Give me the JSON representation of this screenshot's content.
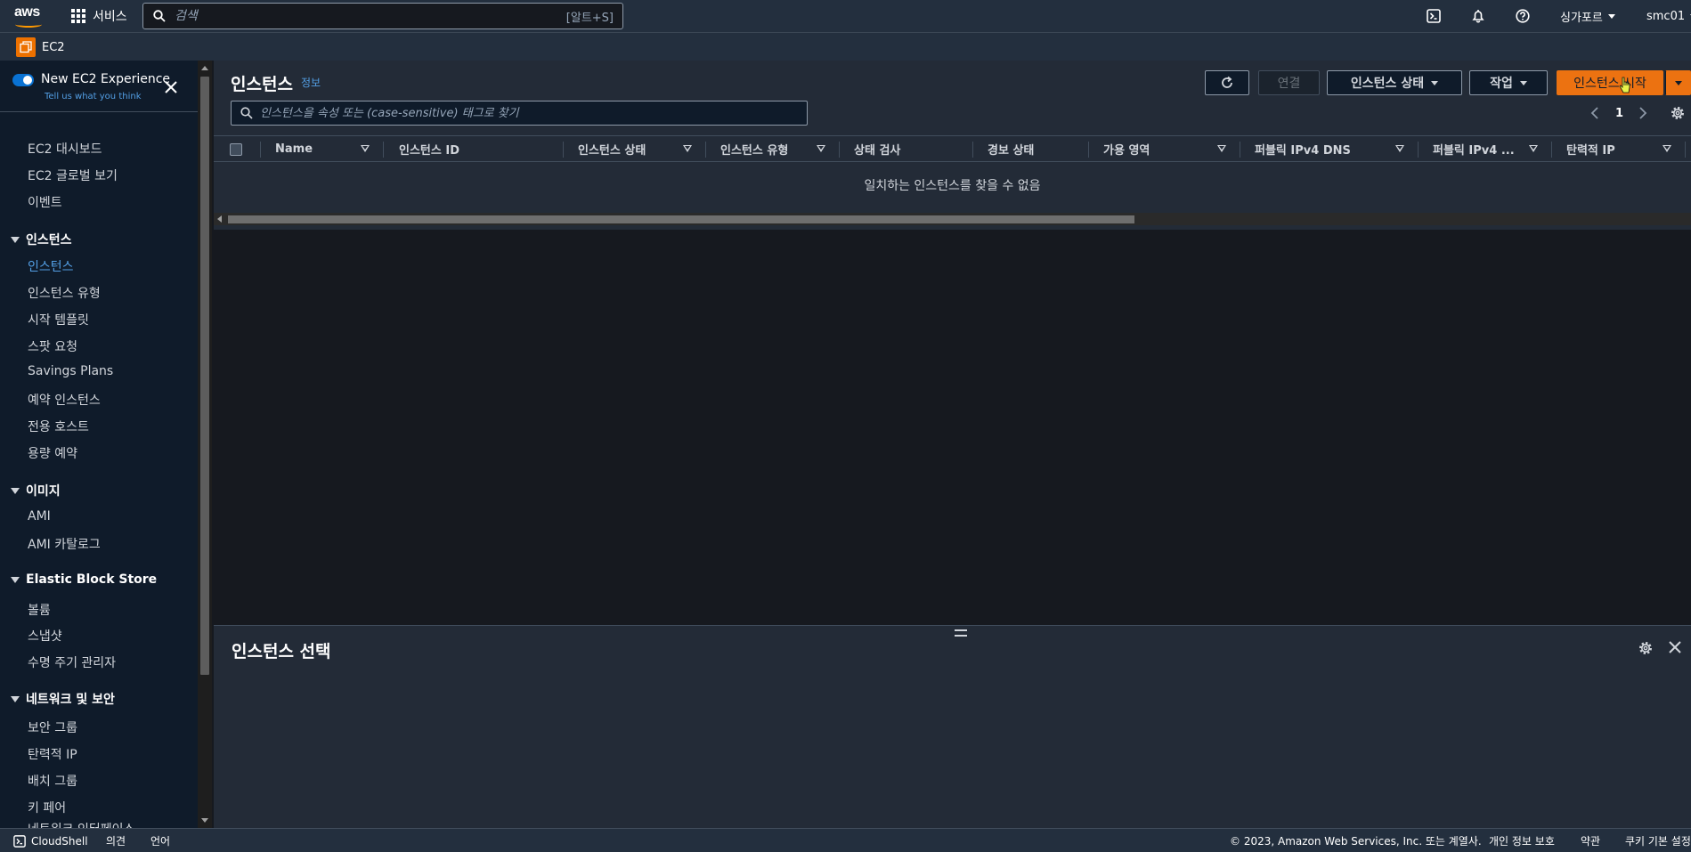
{
  "topnav": {
    "logo_text": "aws",
    "services_label": "서비스",
    "search_placeholder": "검색",
    "search_shortcut": "[알트+S]",
    "region": "싱가포르",
    "account": "smc01"
  },
  "service": {
    "name": "EC2"
  },
  "sidebar": {
    "experience_title": "New EC2 Experience",
    "experience_sub": "Tell us what you think",
    "top_items": [
      "EC2 대시보드",
      "EC2 글로벌 보기",
      "이벤트"
    ],
    "sections": [
      {
        "title": "인스턴스",
        "items": [
          "인스턴스",
          "인스턴스 유형",
          "시작 템플릿",
          "스팟 요청",
          "Savings Plans",
          "예약 인스턴스",
          "전용 호스트",
          "용량 예약"
        ]
      },
      {
        "title": "이미지",
        "items": [
          "AMI",
          "AMI 카탈로그"
        ]
      },
      {
        "title": "Elastic Block Store",
        "items": [
          "볼륨",
          "스냅샷",
          "수명 주기 관리자"
        ]
      },
      {
        "title": "네트워크 및 보안",
        "items": [
          "보안 그룹",
          "탄력적 IP",
          "배치 그룹",
          "키 페어",
          "네트워크 인터페이스"
        ]
      }
    ]
  },
  "main": {
    "title": "인스턴스",
    "info_label": "정보",
    "connect_label": "연결",
    "instance_state_label": "인스턴스 상태",
    "actions_label": "작업",
    "launch_label": "인스턴스 시작",
    "filter_placeholder": "인스턴스을 속성 또는 (case-sensitive) 태그로 찾기",
    "page": "1",
    "columns": [
      "Name",
      "인스턴스 ID",
      "인스턴스 상태",
      "인스턴스 유형",
      "상태 검사",
      "경보 상태",
      "가용 영역",
      "퍼블릭 IPv4 DNS",
      "퍼블릭 IPv4 ...",
      "탄력적 IP"
    ],
    "empty_message": "일치하는 인스턴스를 찾을 수 없음",
    "detail_title": "인스턴스 선택"
  },
  "footer": {
    "cloudshell": "CloudShell",
    "feedback": "의견",
    "language": "언어",
    "copyright": "© 2023, Amazon Web Services, Inc. 또는 계열사.",
    "privacy": "개인 정보 보호",
    "terms": "약관",
    "cookies": "쿠키 기본 설정"
  },
  "colors": {
    "nav_bg": "#232f3e",
    "sidebar_bg": "#0f1b2a",
    "accent_orange": "#ec7211",
    "link_blue": "#539fe5"
  },
  "icons": [
    "aws-logo",
    "grid-icon",
    "search-icon",
    "cloudshell-icon",
    "bell-icon",
    "help-icon",
    "ec2-icon",
    "close-icon",
    "refresh-icon",
    "gear-icon",
    "chevron-left-icon",
    "chevron-right-icon"
  ]
}
